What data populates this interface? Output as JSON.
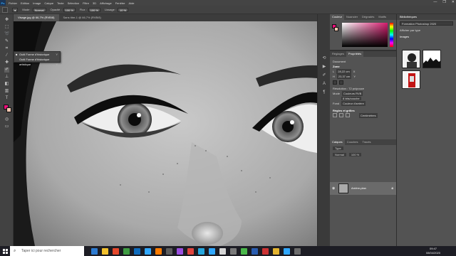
{
  "app": {
    "logo": "Ps",
    "menu": [
      "Fichier",
      "Edition",
      "Image",
      "Calque",
      "Texte",
      "Sélection",
      "Filtre",
      "3D",
      "Affichage",
      "Fenêtre",
      "Aide"
    ],
    "window_controls": [
      "—",
      "❐",
      "✕"
    ]
  },
  "options_bar": {
    "mode_label": "Mode :",
    "mode_value": "Normal",
    "opacity_label": "Opacité :",
    "opacity_value": "100 %",
    "flow_label": "Flux :",
    "flow_value": "100 %",
    "smoothing_label": "Lissage :",
    "smoothing_value": "10 %"
  },
  "tabs": [
    {
      "label": "Visage.jpg @ 66,7% (RVB/8)",
      "active": true
    },
    {
      "label": "Sans titre-1 @ 66,7% (RVB/8)",
      "active": false
    }
  ],
  "flyout": {
    "items": [
      {
        "label": "Outil Forme d'historique",
        "shortcut": "Y",
        "checked": true
      },
      {
        "label": "Outil Forme d'historique artistique",
        "shortcut": "Y",
        "checked": false
      }
    ]
  },
  "color_panel": {
    "tabs": [
      "Couleur",
      "Nuancier",
      "Dégradés",
      "Motifs"
    ],
    "foreground": "#ec0f7a",
    "background": "#f6c7b0"
  },
  "properties_panel": {
    "tabs": [
      "Réglages",
      "Propriétés"
    ],
    "doc_label": "Document",
    "canvas_title": "Zone",
    "width_label": "L",
    "width_value": "28,22 cm",
    "height_label": "H",
    "height_value": "23,37 cm",
    "x_label": "X",
    "y_label": "Y",
    "resolution_label": "Résolution : 72 px/pouce",
    "mode_label": "Mode",
    "mode_value": "Couleurs RVB",
    "depth_value": "8 bits/couche",
    "bg_label": "Fond",
    "bg_value": "Couleur d'arrière",
    "rulers_title": "Règles et grilles",
    "unit_value": "Centimètres"
  },
  "layers_panel": {
    "tabs": [
      "Calques",
      "Couches",
      "Tracés"
    ],
    "kind_label": "Type",
    "mode_value": "Normal",
    "opacity_value": "100 %",
    "layer_name": "Arrière-plan"
  },
  "library": {
    "title": "Bibliothèques",
    "selected_library": "Formation Photoshop 2020",
    "filter_label": "Afficher par type",
    "section_label": "Images"
  },
  "taskbar": {
    "search_placeholder": "Taper ici pour rechercher",
    "time": "09:47",
    "date": "08/04/2020",
    "app_colors": [
      "#2d7bd1",
      "#f2c12e",
      "#e5482b",
      "#3e9c42",
      "#0f6cbd",
      "#31a8ff",
      "#ff7c00",
      "#5d5d5d",
      "#9a4fe0",
      "#e0443e",
      "#26a7de",
      "#31a8ff",
      "#d6d6d6",
      "#7a7a7a",
      "#4ab84a",
      "#2a5db0",
      "#c33",
      "#e3b32f",
      "#31a8ff",
      "#6c6c6c"
    ]
  }
}
